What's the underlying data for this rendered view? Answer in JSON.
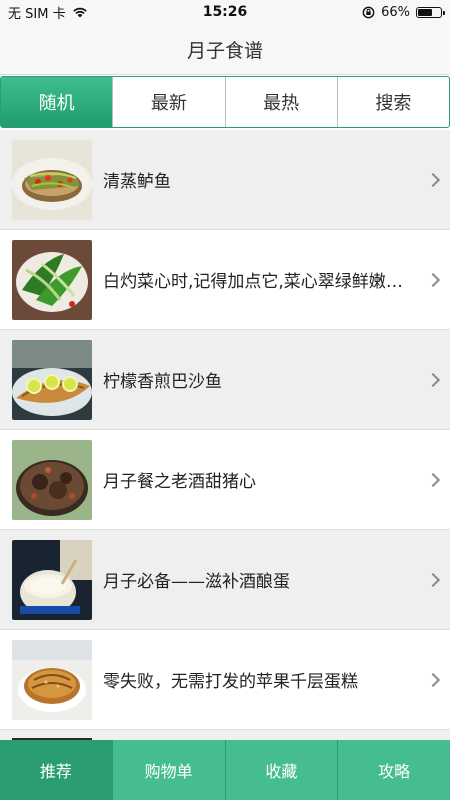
{
  "status_bar": {
    "carrier": "无 SIM 卡",
    "time": "15:26",
    "battery": "66%",
    "battery_level": 0.66
  },
  "nav": {
    "title": "月子食谱"
  },
  "tabs": [
    {
      "label": "随机",
      "active": true
    },
    {
      "label": "最新",
      "active": false
    },
    {
      "label": "最热",
      "active": false
    },
    {
      "label": "搜索",
      "active": false
    }
  ],
  "recipes": [
    {
      "title": "清蒸鲈鱼",
      "image": "steamed-fish"
    },
    {
      "title": "白灼菜心时,记得加点它,菜心翠绿鲜嫩不发黄",
      "image": "greens"
    },
    {
      "title": "柠檬香煎巴沙鱼",
      "image": "lemon-fish"
    },
    {
      "title": "月子餐之老酒甜猪心",
      "image": "pork-heart"
    },
    {
      "title": "月子必备——滋补酒酿蛋",
      "image": "wine-egg"
    },
    {
      "title": "零失败，无需打发的苹果千层蛋糕",
      "image": "apple-cake"
    }
  ],
  "bottom_tabs": [
    {
      "label": "推荐"
    },
    {
      "label": "购物单"
    },
    {
      "label": "收藏"
    },
    {
      "label": "攻略"
    }
  ]
}
